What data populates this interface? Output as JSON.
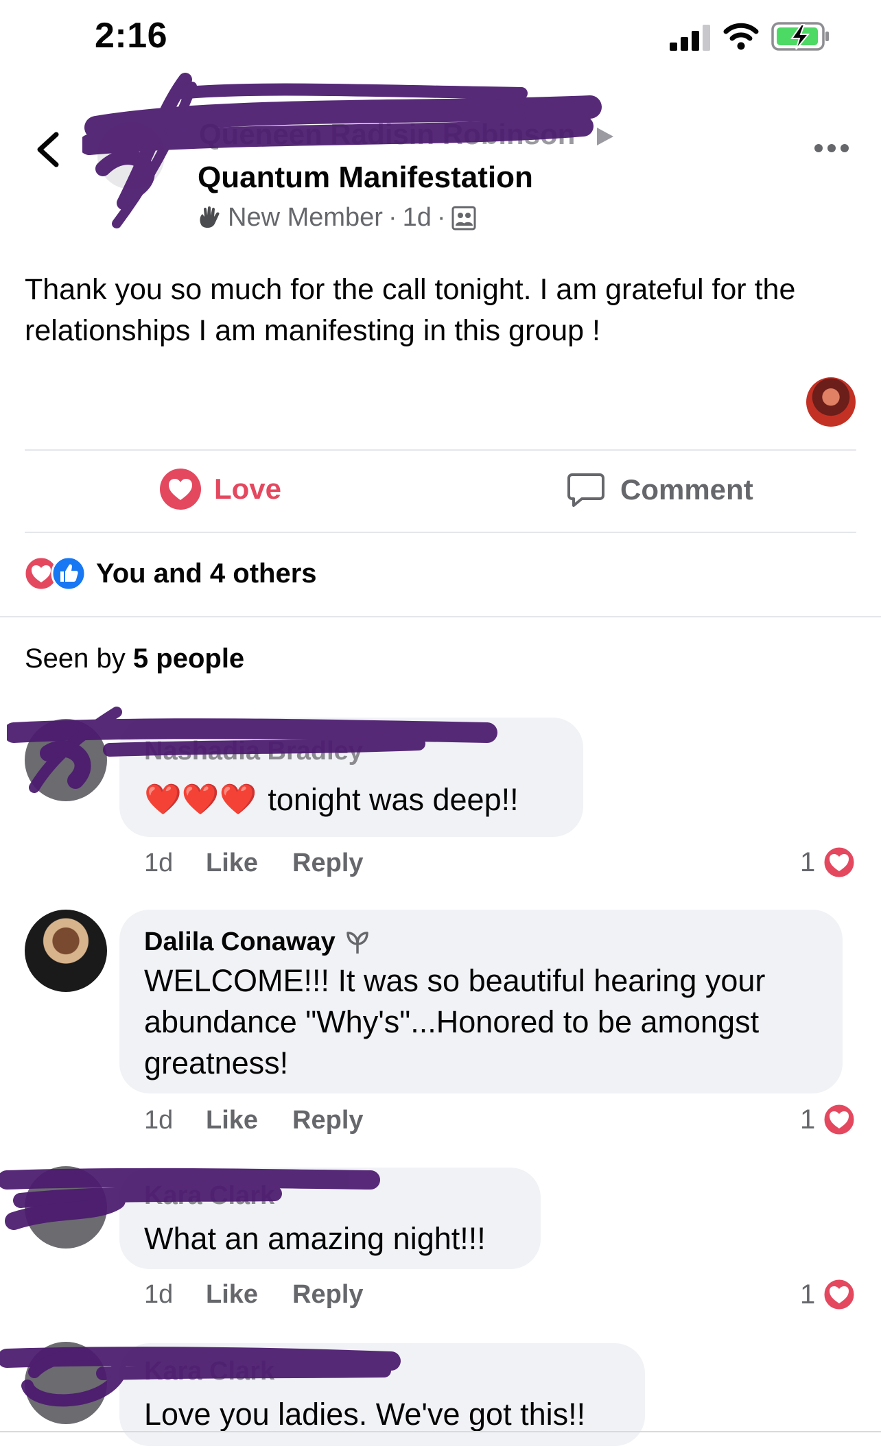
{
  "status_bar": {
    "time": "2:16"
  },
  "post": {
    "author_name": "Queneen Radisin Robinson",
    "group_name": "Quantum Manifestation",
    "badge": "New Member",
    "age": "1d",
    "separator": "·",
    "text": "Thank you so much for the call tonight. I am grateful for the relationships I am manifesting in this group !"
  },
  "actions": {
    "love_label": "Love",
    "comment_label": "Comment"
  },
  "reactions": {
    "summary": "You and 4 others"
  },
  "seen": {
    "prefix": "Seen by",
    "count": "5 people"
  },
  "comments": [
    {
      "name": "Nashadia Bradley",
      "text": "tonight was deep!!",
      "emoji_prefix": "❤️❤️❤️",
      "time": "1d",
      "like": "Like",
      "reply": "Reply",
      "reaction_count": "1"
    },
    {
      "name": "Dalila Conaway",
      "text": "WELCOME!!! It was so beautiful hearing your abundance \"Why's\"...Honored to be amongst greatness!",
      "time": "1d",
      "like": "Like",
      "reply": "Reply",
      "reaction_count": "1"
    },
    {
      "name": "Kara Clark",
      "text": "What an amazing night!!!",
      "time": "1d",
      "like": "Like",
      "reply": "Reply",
      "reaction_count": "1"
    },
    {
      "name": "Kara Clark",
      "text": "Love you ladies. We've got this!!"
    }
  ],
  "colors": {
    "love": "#e4485f",
    "like_blue": "#1877f2",
    "muted": "#65676b",
    "bubble": "#f0f2f5",
    "redaction": "#4b1a6e"
  }
}
